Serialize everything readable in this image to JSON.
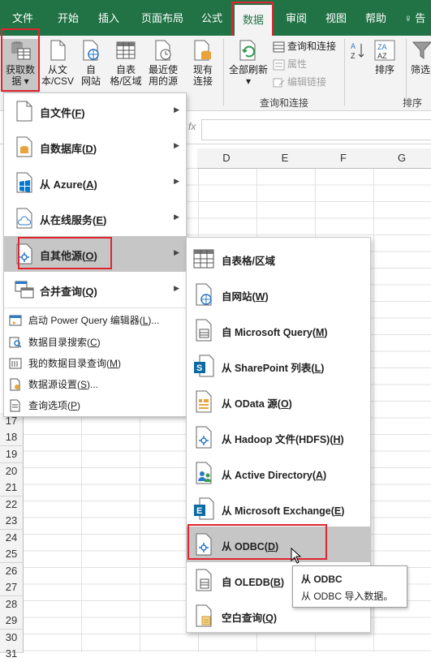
{
  "tabs": [
    "文件",
    "开始",
    "插入",
    "页面布局",
    "公式",
    "数据",
    "审阅",
    "视图",
    "帮助",
    "告"
  ],
  "active_tab": "数据",
  "ribbon": {
    "get_data": [
      "获取数",
      "据 ▾"
    ],
    "from_text": [
      "从文",
      "本/CSV"
    ],
    "from_web": [
      "自",
      "网站"
    ],
    "from_table": [
      "自表",
      "格/区域"
    ],
    "recent_sources": [
      "最近使",
      "用的源"
    ],
    "existing_conn": [
      "现有",
      "连接"
    ],
    "refresh_all": [
      "全部刷新",
      "▾"
    ],
    "queries_conn": "查询和连接",
    "properties": "属性",
    "edit_links": "编辑链接",
    "group_queries": "查询和连接",
    "sort": "排序",
    "filter": "筛选",
    "group_sort": "排序和"
  },
  "formula_bar": {
    "fx": "fx"
  },
  "columns": [
    "D",
    "E",
    "F",
    "G"
  ],
  "rows": [
    "17",
    "18",
    "19",
    "20",
    "21",
    "22",
    "23",
    "24",
    "25",
    "26",
    "27",
    "28",
    "29",
    "30",
    "31"
  ],
  "menu": {
    "items": [
      {
        "label": "自文件(",
        "key": "F",
        "end": ")",
        "arrow": "▶"
      },
      {
        "label": "自数据库(",
        "key": "D",
        "end": ")",
        "arrow": "▶"
      },
      {
        "label": "从 Azure(",
        "key": "A",
        "end": ")",
        "arrow": "▶"
      },
      {
        "label": "从在线服务(",
        "key": "E",
        "end": ")",
        "arrow": "▶"
      },
      {
        "label": "自其他源(",
        "key": "O",
        "end": ")",
        "arrow": "▶"
      },
      {
        "label": "合并查询(",
        "key": "Q",
        "end": ")",
        "arrow": "▶"
      }
    ],
    "small": [
      {
        "label": "启动 Power Query 编辑器(",
        "key": "L",
        "end": ")..."
      },
      {
        "label": "数据目录搜索(",
        "key": "C",
        "end": ")"
      },
      {
        "label": "我的数据目录查询(",
        "key": "M",
        "end": ")"
      },
      {
        "label": "数据源设置(",
        "key": "S",
        "end": ")..."
      },
      {
        "label": "查询选项(",
        "key": "P",
        "end": ")"
      }
    ]
  },
  "submenu": {
    "items": [
      {
        "label": "自表格/区域",
        "key": "",
        "end": ""
      },
      {
        "label": "自网站(",
        "key": "W",
        "end": ")"
      },
      {
        "label": "自 Microsoft Query(",
        "key": "M",
        "end": ")"
      },
      {
        "label": "从 SharePoint 列表(",
        "key": "L",
        "end": ")"
      },
      {
        "label": "从 OData 源(",
        "key": "O",
        "end": ")"
      },
      {
        "label": "从 Hadoop 文件(HDFS)(",
        "key": "H",
        "end": ")"
      },
      {
        "label": "从 Active Directory(",
        "key": "A",
        "end": ")"
      },
      {
        "label": "从 Microsoft Exchange(",
        "key": "E",
        "end": ")"
      },
      {
        "label": "从 ODBC(",
        "key": "D",
        "end": ")"
      },
      {
        "label": "自 OLEDB(",
        "key": "B",
        "end": ")"
      },
      {
        "label": "空白查询(",
        "key": "Q",
        "end": ")"
      }
    ]
  },
  "tooltip": {
    "title": "从 ODBC",
    "desc": "从 ODBC 导入数据。"
  },
  "colors": {
    "excel_green": "#217346",
    "highlight": "#c6c6c6",
    "annotation_red": "#e0252f"
  }
}
